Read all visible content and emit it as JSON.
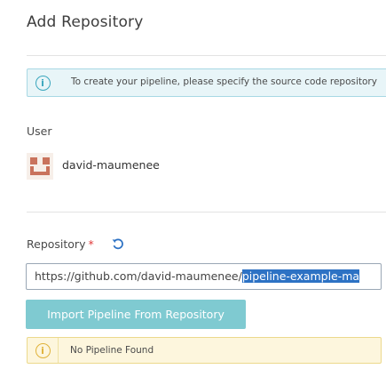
{
  "page": {
    "title": "Add Repository"
  },
  "info_alert": {
    "icon": "info-circle-icon",
    "text": "To create your pipeline, please specify the source code repository"
  },
  "user_section": {
    "label": "User",
    "username": "david-maumenee",
    "avatar_color": "#c9735d"
  },
  "repository_section": {
    "label": "Repository",
    "required_mark": "*",
    "refresh_icon": "refresh-icon",
    "url_prefix": "https://github.com/david-maumenee/",
    "url_selected": "pipeline-example-ma"
  },
  "import_button": {
    "label": "Import Pipeline From Repository",
    "color": "#7fcad1"
  },
  "warning_alert": {
    "icon": "warning-circle-icon",
    "text": "No Pipeline Found"
  }
}
